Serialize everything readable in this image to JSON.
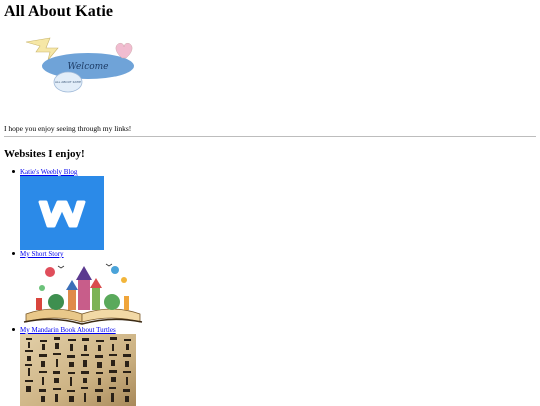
{
  "page": {
    "title": "All About Katie",
    "banner": {
      "script_text": "Welcome",
      "badge_text": "ALL ABOUT KATIE"
    },
    "intro_text": "I hope you enjoy seeing through my links!",
    "section_heading": "Websites I enjoy!"
  },
  "links": [
    {
      "label": "Katie's Weebly Blog",
      "image": "weebly-logo"
    },
    {
      "label": "My Short Story",
      "image": "storybook-illustration"
    },
    {
      "label": "My Mandarin Book About Turtles",
      "image": "chinese-calligraphy-scroll"
    }
  ],
  "colors": {
    "link": "#0000ee",
    "weebly_blue": "#2b8ae8",
    "banner_blue": "#6fa3d8",
    "heart_pink": "#f1bcd0",
    "bolt_yellow": "#f6e7a6",
    "paper_tan": "#d8c29a"
  }
}
